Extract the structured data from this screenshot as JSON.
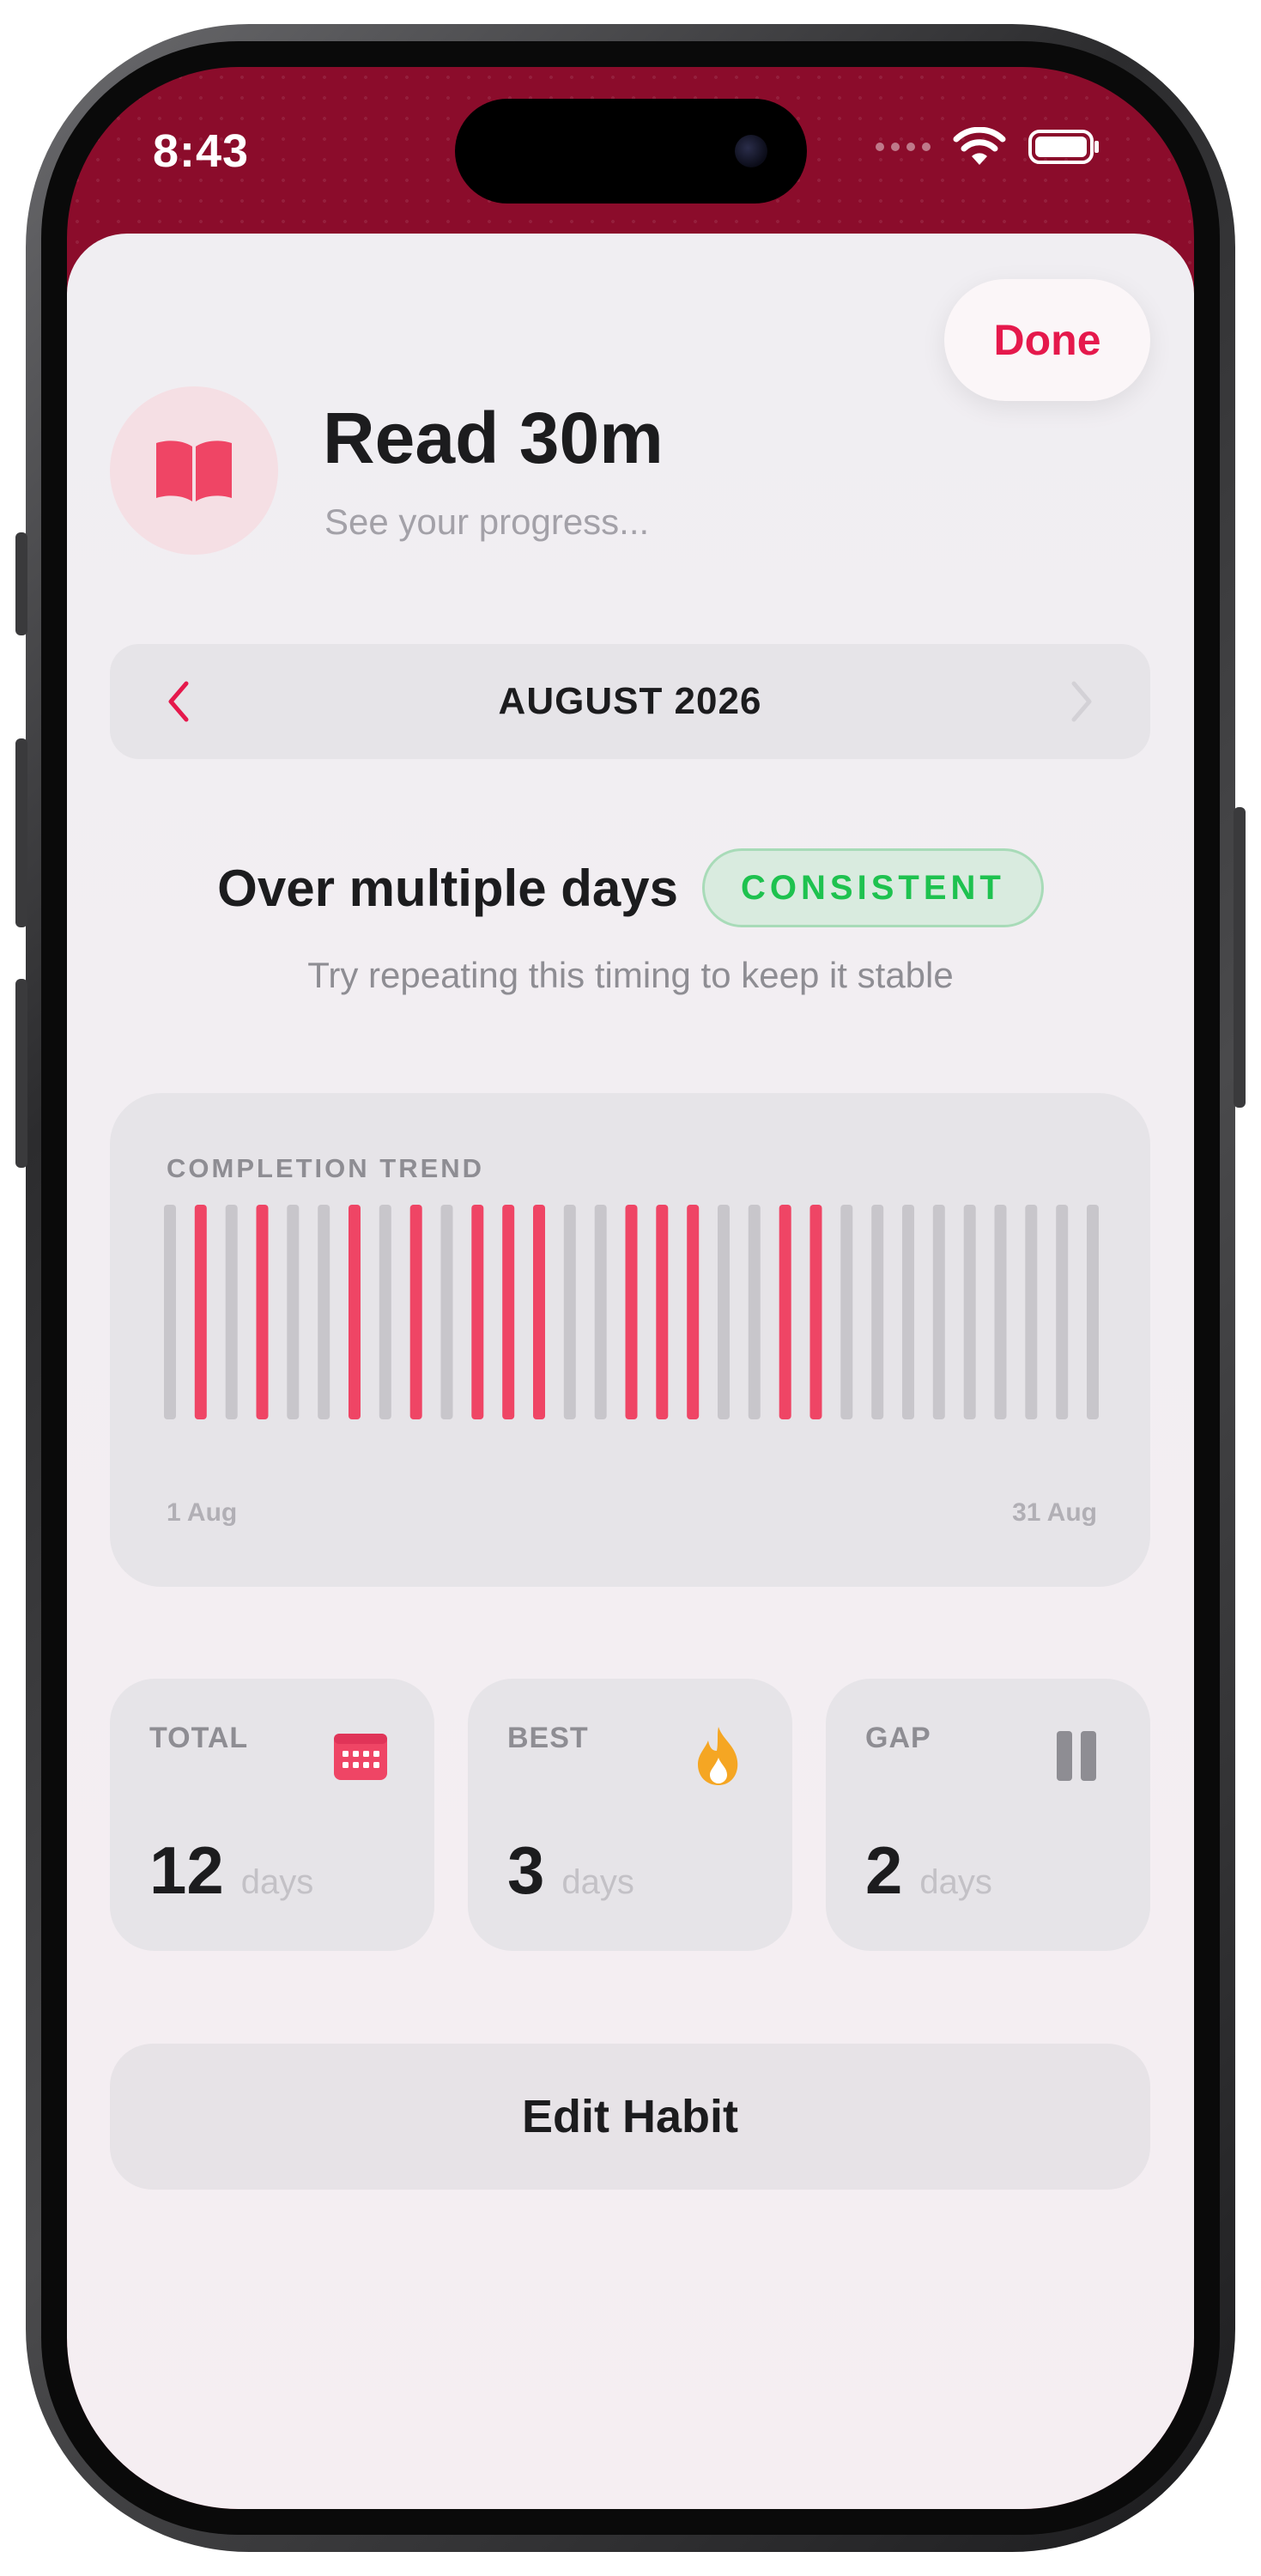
{
  "status_bar": {
    "time": "8:43"
  },
  "header": {
    "done_label": "Done",
    "habit_title": "Read 30m",
    "habit_subtitle": "See your progress..."
  },
  "month_nav": {
    "label": "AUGUST 2026"
  },
  "insight": {
    "title": "Over multiple days",
    "badge": "CONSISTENT",
    "subtitle": "Try repeating this timing to keep it stable"
  },
  "chart_data": {
    "type": "bar",
    "title": "COMPLETION TREND",
    "x_start_label": "1 Aug",
    "x_end_label": "31 Aug",
    "days": 31,
    "completed": [
      0,
      1,
      0,
      1,
      0,
      0,
      1,
      0,
      1,
      0,
      1,
      1,
      1,
      0,
      0,
      1,
      1,
      1,
      0,
      0,
      1,
      1,
      0,
      0,
      0,
      0,
      0,
      0,
      0,
      0,
      0
    ],
    "colors": {
      "done": "#ef4565",
      "missed": "#c8c6cb"
    }
  },
  "stats": [
    {
      "label": "TOTAL",
      "value": "12",
      "unit": "days",
      "icon": "calendar-icon"
    },
    {
      "label": "BEST",
      "value": "3",
      "unit": "days",
      "icon": "flame-icon"
    },
    {
      "label": "GAP",
      "value": "2",
      "unit": "days",
      "icon": "pause-icon"
    }
  ],
  "actions": {
    "edit_label": "Edit Habit"
  },
  "colors": {
    "accent": "#e5194c",
    "header_bg": "#8b0c2b",
    "success": "#1ec24f",
    "flame": "#f5a623"
  }
}
